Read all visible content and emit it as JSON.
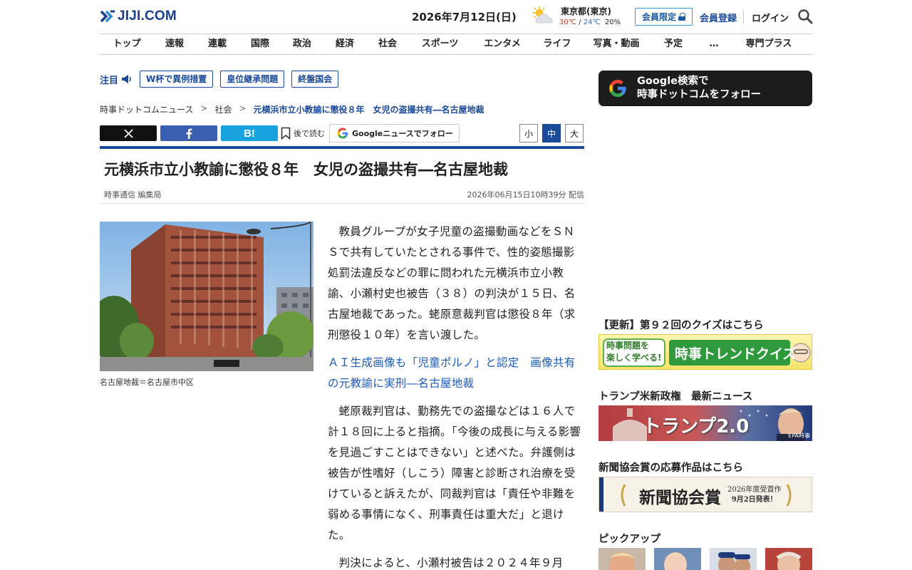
{
  "header": {
    "logo_text": "JIJI.COM",
    "date": "2026年7月12日(日)",
    "weather": {
      "city": "東京都(東京)",
      "high": "30℃",
      "separator": "/",
      "low": "24℃",
      "rain": "20%",
      "icon": "sun-cloud-icon"
    },
    "member_only": "会員限定",
    "register": "会員登録",
    "login": "ログイン"
  },
  "nav": {
    "items": [
      "トップ",
      "速報",
      "連載",
      "国際",
      "政治",
      "経済",
      "社会",
      "スポーツ",
      "エンタメ",
      "ライフ",
      "写真・動画",
      "予定",
      "…",
      "専門プラス"
    ]
  },
  "trending": {
    "label": "注目",
    "tags": [
      "W杯で異例措置",
      "皇位継承問題",
      "終盤国会"
    ]
  },
  "breadcrumb": {
    "items": [
      "時事ドットコムニュース",
      "社会",
      "元横浜市立小教諭に懲役８年　女児の盗撮共有―名古屋地裁"
    ],
    "separator": ">"
  },
  "share": {
    "later": "後で読む",
    "google_news": "Googleニュースでフォロー",
    "font_sizes": [
      "小",
      "中",
      "大"
    ],
    "selected_size": "中"
  },
  "article": {
    "headline": "元横浜市立小教諭に懲役８年　女児の盗撮共有―名古屋地裁",
    "byline": "時事通信 編集局",
    "pubdate": "2026年06月15日10時39分 配信",
    "caption": "名古屋地裁＝名古屋市中区",
    "paragraph1": "教員グループが女子児童の盗撮動画などをＳＮＳで共有していたとされる事件で、性的姿態撮影処罰法違反などの罪に問われた元横浜市立小教諭、小瀬村史也被告（３８）の判決が１５日、名古屋地裁であった。蛯原意裁判官は懲役８年（求刑懲役１０年）を言い渡した。",
    "related_link": "ＡＩ生成画像も「児童ポルノ」と認定　画像共有の元教諭に実刑―名古屋地裁",
    "paragraph2": "蛯原裁判官は、勤務先での盗撮などは１６人で計１８回に上ると指摘。「今後の成長に与える影響を見過ごすことはできない」と述べた。弁護側は被告が性嗜好（しこう）障害と診断され治療を受けていると訴えたが、同裁判官は「責任や非難を弱める事情になく、刑事責任は重大だ」と退けた。",
    "paragraph3": "判決によると、小瀬村被告は２０２４年９月"
  },
  "sidebar": {
    "google_follow_line1": "Google検索で",
    "google_follow_line2": "時事ドットコムをフォロー",
    "quiz_title": "【更新】第９２回のクイズはこちら",
    "quiz_banner_left1": "時事問題を",
    "quiz_banner_left2": "楽しく学べる!",
    "quiz_banner_main": "時事トレンドクイズ",
    "trump_title": "トランプ米新政権　最新ニュース",
    "trump_banner": "トランプ2.0",
    "trump_credit": "EPA時事",
    "shinbun_title": "新聞協会賞の応募作品はこちら",
    "shinbun_banner": "新聞協会賞",
    "shinbun_sub1": "2026年度受賞作",
    "shinbun_sub2": "9月2日発表！",
    "pickup_title": "ピックアップ"
  },
  "colors": {
    "brand_blue": "#1a4a9a",
    "link_blue": "#1a5aba",
    "facebook": "#3b5fb0",
    "hatena": "#19a3de"
  }
}
